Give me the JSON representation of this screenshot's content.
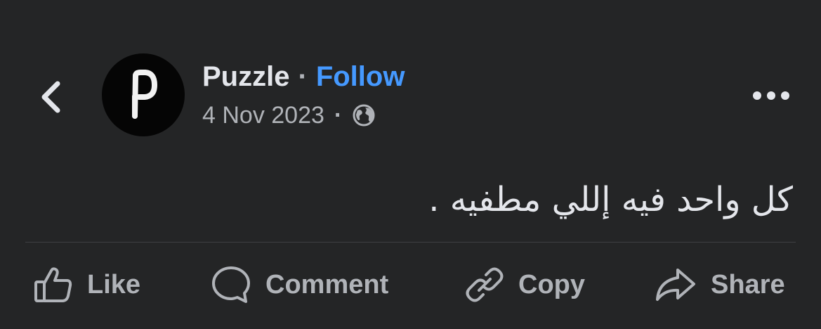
{
  "post": {
    "page_name": "Puzzle",
    "separator": "·",
    "follow_label": "Follow",
    "avatar_letter": "P",
    "date": "4 Nov 2023",
    "meta_separator": "·",
    "audience_icon": "globe-icon",
    "text": "كل واحد فيه إللي مطفيه ."
  },
  "actions": {
    "like_label": "Like",
    "comment_label": "Comment",
    "copy_label": "Copy",
    "share_label": "Share"
  },
  "icons": {
    "back": "chevron-left-icon",
    "more": "more-horizontal-icon",
    "like": "thumbs-up-icon",
    "comment": "comment-bubble-icon",
    "copy": "link-icon",
    "share": "share-arrow-icon"
  },
  "colors": {
    "background": "#242526",
    "primary_text": "#e4e6eb",
    "secondary_text": "#b0b3b8",
    "accent": "#4599ff",
    "divider": "#3e4042"
  }
}
